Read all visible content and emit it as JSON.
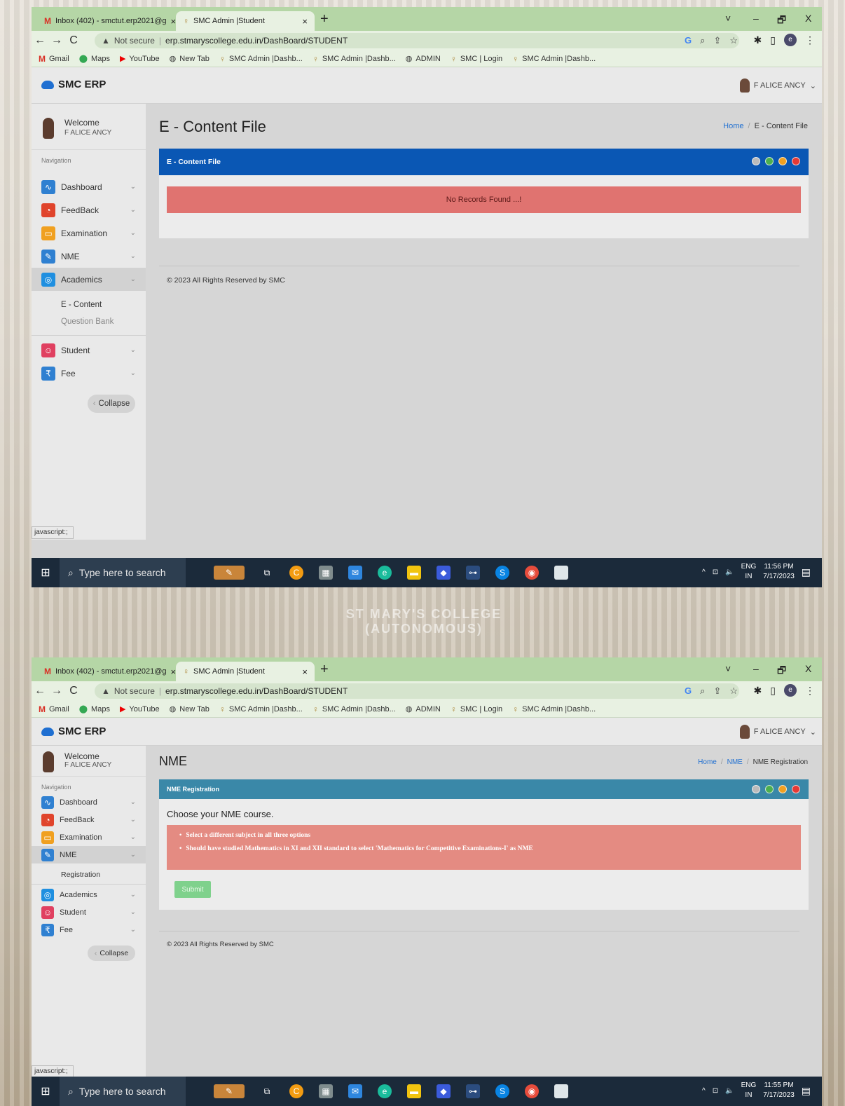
{
  "screen1": {
    "browser": {
      "tabs": [
        {
          "title": "Inbox (402) - smctut.erp2021@g",
          "close": "×"
        },
        {
          "title": "SMC Admin |Student",
          "close": "×"
        }
      ],
      "new_tab": "+",
      "window_controls": [
        "˅",
        "–",
        "🗗",
        "X"
      ],
      "security": "Not secure",
      "url": "erp.stmaryscollege.edu.in/DashBoard/STUDENT",
      "bookmarks": [
        "Gmail",
        "Maps",
        "YouTube",
        "New Tab",
        "SMC Admin |Dashb...",
        "SMC Admin |Dashb...",
        "ADMIN",
        "SMC | Login",
        "SMC Admin |Dashb..."
      ]
    },
    "app": {
      "brand": "SMC ERP",
      "user": "F ALICE ANCY",
      "welcome": "Welcome",
      "welcome_name": "F ALICE ANCY",
      "nav_label": "Navigation",
      "nav": [
        "Dashboard",
        "FeedBack",
        "Examination",
        "NME",
        "Academics"
      ],
      "sub_items": [
        "E - Content",
        "Question Bank"
      ],
      "nav_after": [
        "Student",
        "Fee"
      ],
      "collapse": "Collapse",
      "page_title": "E - Content File",
      "breadcrumb": [
        "Home",
        "E - Content File"
      ],
      "panel_title": "E - Content File",
      "empty_message": "No Records Found ...!",
      "footer": "© 2023 All Rights Reserved by SMC",
      "status_hint": "javascript:;"
    },
    "taskbar": {
      "search": "Type here to search",
      "lang": "ENG",
      "region": "IN",
      "time": "11:56 PM",
      "date": "7/17/2023"
    }
  },
  "background_sign": "ST MARY'S COLLEGE (AUTONOMOUS)",
  "screen2": {
    "browser": {
      "tabs": [
        {
          "title": "Inbox (402) - smctut.erp2021@g",
          "close": "×"
        },
        {
          "title": "SMC Admin |Student",
          "close": "×"
        }
      ],
      "new_tab": "+",
      "window_controls": [
        "˅",
        "–",
        "🗗",
        "X"
      ],
      "security": "Not secure",
      "url": "erp.stmaryscollege.edu.in/DashBoard/STUDENT",
      "bookmarks": [
        "Gmail",
        "Maps",
        "YouTube",
        "New Tab",
        "SMC Admin |Dashb...",
        "SMC Admin |Dashb...",
        "ADMIN",
        "SMC | Login",
        "SMC Admin |Dashb..."
      ]
    },
    "app": {
      "brand": "SMC ERP",
      "user": "F ALICE ANCY",
      "welcome": "Welcome",
      "welcome_name": "F ALICE ANCY",
      "nav_label": "Navigation",
      "nav": [
        "Dashboard",
        "FeedBack",
        "Examination",
        "NME"
      ],
      "sub_items": [
        "Registration"
      ],
      "nav_after": [
        "Academics",
        "Student",
        "Fee"
      ],
      "collapse": "Collapse",
      "page_title": "NME",
      "breadcrumb": [
        "Home",
        "NME",
        "NME Registration"
      ],
      "panel_title": "NME Registration",
      "choose_text": "Choose your NME course.",
      "alerts": [
        "Select a different subject in all three options",
        "Should have studied Mathematics in XI and XII standard to select 'Mathematics for Competitive Examinations-I' as NME"
      ],
      "submit": "Submit",
      "footer": "© 2023 All Rights Reserved by SMC",
      "status_hint": "javascript:;"
    },
    "taskbar": {
      "search": "Type here to search",
      "lang": "ENG",
      "region": "IN",
      "time": "11:55 PM",
      "date": "7/17/2023"
    }
  },
  "colors": {
    "panel_blue": "#0a57b4",
    "panel_teal": "#3a88a8",
    "alert_red": "#e07370",
    "alert_light": "#e48b82",
    "submit_green": "#7fd18c"
  }
}
